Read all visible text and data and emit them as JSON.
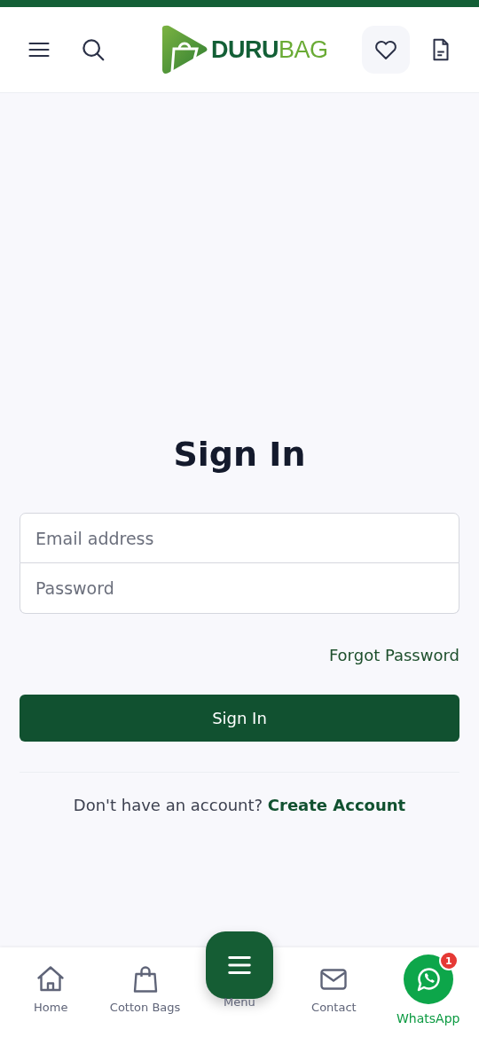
{
  "header": {
    "logo": {
      "part_1": "DURU",
      "part_2": "BAG"
    }
  },
  "form": {
    "title": "Sign In",
    "fields": [
      {
        "placeholder": "Email address"
      },
      {
        "placeholder": "Password"
      }
    ],
    "forgot_link": "Forgot Password",
    "submit": "Sign In",
    "signup_prompt": "Don't have an account?",
    "signup_link": "Create Account"
  },
  "bottom_nav": [
    {
      "kind": "home",
      "label": "Home"
    },
    {
      "kind": "bag",
      "label": "Cotton Bags"
    },
    {
      "kind": "menu",
      "label": "Menu"
    },
    {
      "kind": "mail",
      "label": "Contact"
    },
    {
      "kind": "whatsapp",
      "label": "WhatsApp",
      "badge": "1"
    }
  ]
}
